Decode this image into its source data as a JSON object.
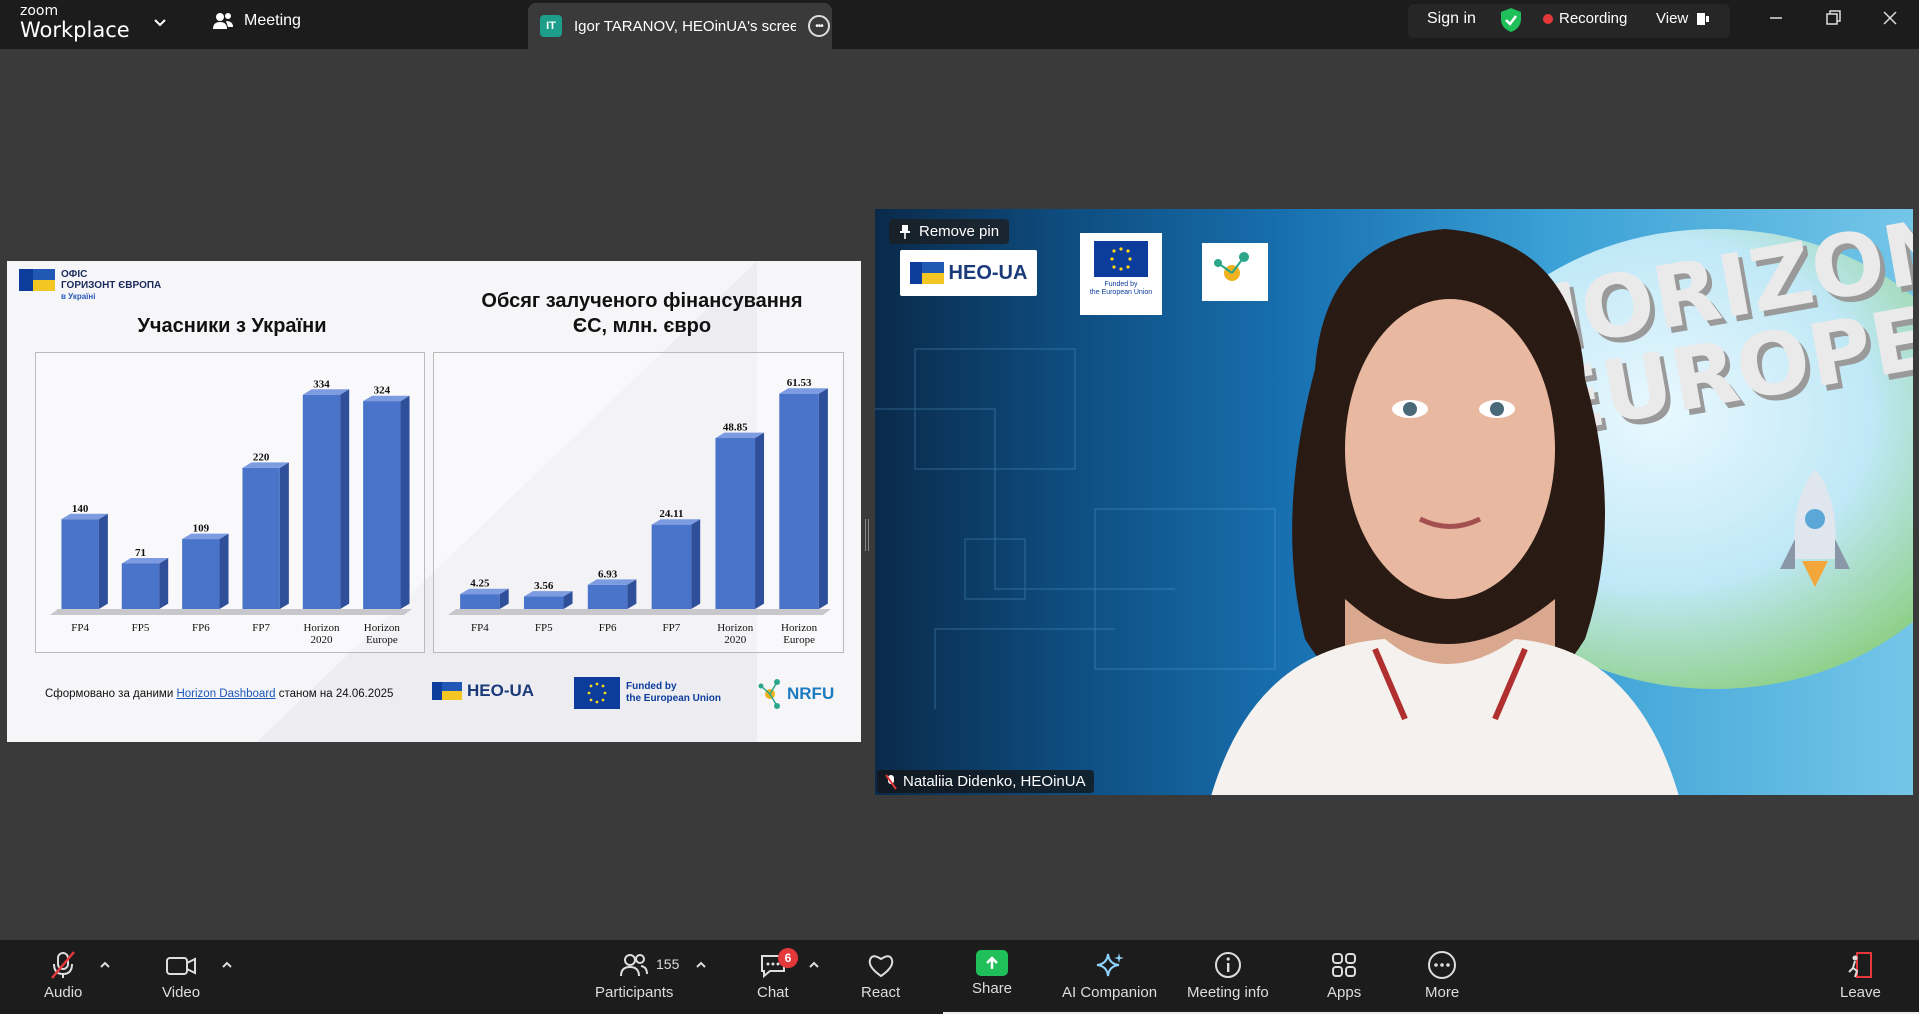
{
  "app": {
    "brand_top": "zoom",
    "brand_bottom": "Workplace",
    "meeting_menu": "Meeting"
  },
  "tab": {
    "initials": "IT",
    "title": "Igor TARANOV, HEOinUA's screen"
  },
  "header": {
    "sign_in": "Sign in",
    "recording": "Recording",
    "view": "View"
  },
  "slide": {
    "office_line1": "ОФІС",
    "office_line2": "ГОРИЗОНТ ЄВРОПА",
    "office_line3": "в Україні",
    "source_prefix": "Сформовано за даними",
    "source_link": "Horizon Dashboard",
    "source_suffix": "станом на 24.06.2025",
    "heo_label": "HEO-UA",
    "eu_line1": "Funded by",
    "eu_line2": "the European Union",
    "nrfu_label": "NRFU"
  },
  "chart_data": [
    {
      "type": "bar",
      "title": "Учасники з України",
      "categories": [
        "FP4",
        "FP5",
        "FP6",
        "FP7",
        "Horizon 2020",
        "Horizon Europe"
      ],
      "values": [
        140,
        71,
        109,
        220,
        334,
        324
      ],
      "value_labels": [
        "140",
        "71",
        "109",
        "220",
        "334",
        "324"
      ],
      "ylim": [
        0,
        360
      ],
      "color": "#4a74c9"
    },
    {
      "type": "bar",
      "title": "Обсяг залученого фінансування ЄС, млн. євро",
      "categories": [
        "FP4",
        "FP5",
        "FP6",
        "FP7",
        "Horizon 2020",
        "Horizon Europe"
      ],
      "values": [
        4.25,
        3.56,
        6.93,
        24.11,
        48.85,
        61.53
      ],
      "value_labels": [
        "4.25",
        "3.56",
        "6.93",
        "24.11",
        "48.85",
        "61.53"
      ],
      "ylim": [
        0,
        66
      ],
      "color": "#4a74c9"
    }
  ],
  "video": {
    "remove_pin": "Remove pin",
    "participant_name": "Nataliia Didenko, HEOinUA",
    "bg_line1": "HORIZON",
    "bg_line2": "EUROPE",
    "heo_label": "HEO-UA",
    "eu_line1": "Funded by",
    "eu_line2": "the European Union"
  },
  "toolbar": {
    "audio": "Audio",
    "video": "Video",
    "participants": "Participants",
    "participants_count": "155",
    "chat": "Chat",
    "chat_badge": "6",
    "react": "React",
    "share": "Share",
    "ai_companion": "AI Companion",
    "meeting_info": "Meeting info",
    "apps": "Apps",
    "more": "More",
    "leave": "Leave"
  },
  "colors": {
    "accent_green": "#1fbf5a",
    "record_red": "#e5383b",
    "shield_green": "#1fbf5a",
    "bar_blue": "#4a74c9"
  }
}
